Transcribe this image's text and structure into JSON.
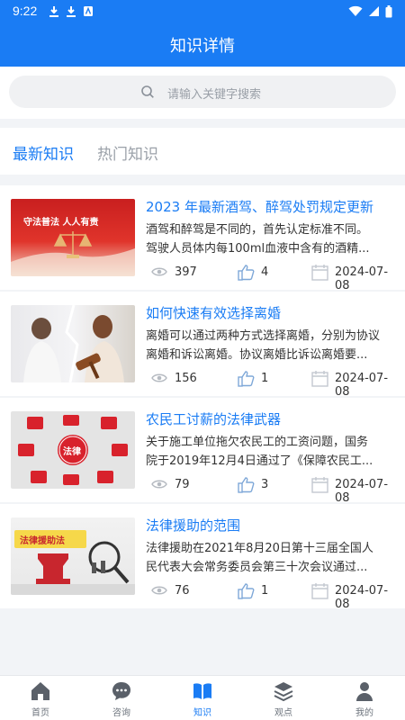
{
  "status_bar": {
    "time": "9:22"
  },
  "header": {
    "title": "知识详情"
  },
  "search": {
    "placeholder": "请输入关键字搜索"
  },
  "tabs": [
    {
      "label": "最新知识",
      "active": true
    },
    {
      "label": "热门知识",
      "active": false
    }
  ],
  "articles": [
    {
      "title": "2023 年最新酒驾、醉驾处罚规定更新",
      "desc_line1": "酒驾和醉驾是不同的，首先认定标准不同。",
      "desc_line2": "驾驶人员体内每100ml血液中含有的酒精...",
      "views": "397",
      "likes": "4",
      "date": "2024-07-08",
      "image_text": "守法普法  人人有责"
    },
    {
      "title": "如何快速有效选择离婚",
      "desc_line1": "离婚可以通过两种方式选择离婚，分别为协议",
      "desc_line2": "离婚和诉讼离婚。协议离婚比诉讼离婚要...",
      "views": "156",
      "likes": "1",
      "date": "2024-07-08"
    },
    {
      "title": "农民工讨薪的法律武器",
      "desc_line1": "关于施工单位拖欠农民工的工资问题，国务",
      "desc_line2": "院于2019年12月4日通过了《保障农民工...",
      "views": "79",
      "likes": "3",
      "date": "2024-07-08",
      "image_text": "法律"
    },
    {
      "title": "法律援助的范围",
      "desc_line1": "法律援助在2021年8月20日第十三届全国人",
      "desc_line2": "民代表大会常务委员会第三十次会议通过...",
      "views": "76",
      "likes": "1",
      "date": "2024-07-08",
      "image_text": "法律援助法"
    }
  ],
  "tab_bar": [
    {
      "label": "首页",
      "icon": "home-icon"
    },
    {
      "label": "咨询",
      "icon": "chat-icon"
    },
    {
      "label": "知识",
      "icon": "book-icon",
      "active": true
    },
    {
      "label": "观点",
      "icon": "layers-icon"
    },
    {
      "label": "我的",
      "icon": "user-icon"
    }
  ],
  "colors": {
    "accent": "#1a7cf4",
    "background": "#f2f4f7"
  }
}
